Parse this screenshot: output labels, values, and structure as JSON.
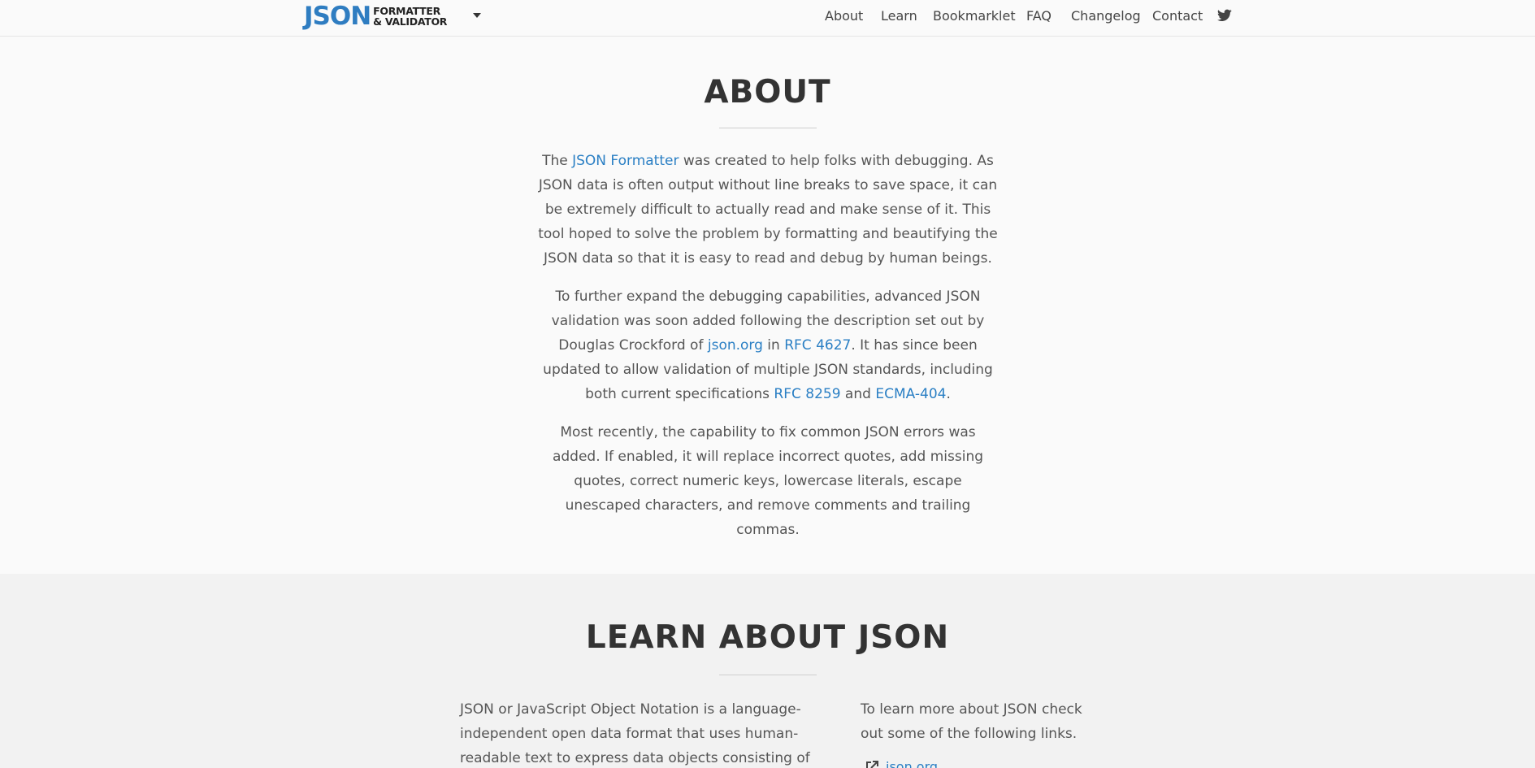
{
  "header": {
    "logo_main": "JSON",
    "logo_line1": "FORMATTER",
    "logo_line2": "& VALIDATOR",
    "nav": [
      "About",
      "Learn",
      "Bookmarklet",
      "FAQ",
      "Changelog",
      "Contact"
    ],
    "social_icon": "twitter-icon"
  },
  "about": {
    "title": "ABOUT",
    "p1": {
      "a": "The ",
      "link1": "JSON Formatter",
      "b": " was created to help folks with debugging. As JSON data is often output without line breaks to save space, it can be extremely difficult to actually read and make sense of it. This tool hoped to solve the problem by formatting and beautifying the JSON data so that it is easy to read and debug by human beings."
    },
    "p2": {
      "a": "To further expand the debugging capabilities, advanced JSON validation was soon added following the description set out by Douglas Crockford of ",
      "link1": "json.org",
      "b": " in ",
      "link2": "RFC 4627",
      "c": ". It has since been updated to allow validation of multiple JSON standards, including both current specifications ",
      "link3": "RFC 8259",
      "d": " and ",
      "link4": "ECMA-404",
      "e": "."
    },
    "p3": "Most recently, the capability to fix common JSON errors was added. If enabled, it will replace incorrect quotes, add missing quotes, correct numeric keys, lowercase literals, escape unescaped characters, and remove comments and trailing commas."
  },
  "learn": {
    "title": "LEARN ABOUT JSON",
    "left_text": "JSON or JavaScript Object Notation is a language-independent open data format that uses human-readable text to express data objects consisting of attribute-value",
    "right_text": "To learn more about JSON check out some of the following links.",
    "first_link": "json.org"
  },
  "colors": {
    "accent": "#2a7fc4",
    "logo_blue": "#2f7dc1",
    "heading": "#333333",
    "body_text": "#555555"
  }
}
